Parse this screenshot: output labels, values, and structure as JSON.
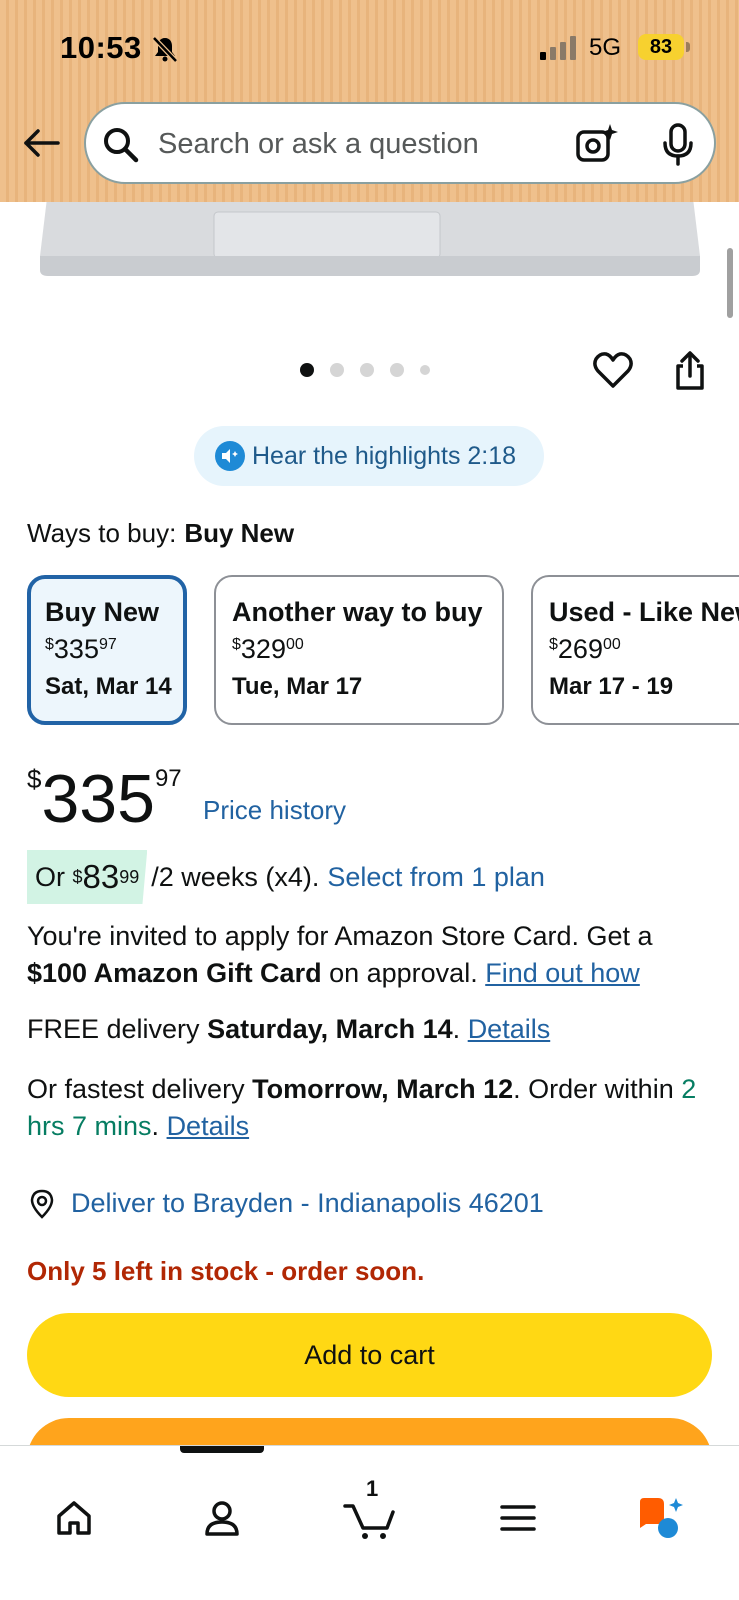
{
  "status_bar": {
    "time": "10:53",
    "network": "5G",
    "battery": "83"
  },
  "search": {
    "placeholder": "Search or ask a question"
  },
  "highlights": {
    "label": "Hear the highlights 2:18"
  },
  "ways_to_buy": {
    "label": "Ways to buy:",
    "selected": "Buy New",
    "options": [
      {
        "title": "Buy New",
        "price_whole": "335",
        "price_fraction": "97",
        "date": "Sat, Mar 14",
        "selected": true
      },
      {
        "title": "Another way to buy",
        "price_whole": "329",
        "price_fraction": "00",
        "date": "Tue, Mar 17",
        "selected": false
      },
      {
        "title": "Used - Like New",
        "price_whole": "269",
        "price_fraction": "00",
        "date": "Mar 17 - 19",
        "selected": false
      }
    ]
  },
  "price": {
    "currency": "$",
    "whole": "335",
    "fraction": "97",
    "history_link": "Price history"
  },
  "installment": {
    "prefix": "Or",
    "currency": "$",
    "amount_whole": "83",
    "amount_fraction": "99",
    "terms": "/2 weeks (x4).",
    "link": "Select from 1 plan"
  },
  "store_card": {
    "text_1": "You're invited to apply for Amazon Store Card. Get a",
    "bold": "$100 Amazon Gift Card",
    "text_2": "on approval.",
    "link": "Find out how"
  },
  "free_delivery": {
    "prefix": "FREE delivery",
    "date": "Saturday, March 14",
    "link": "Details"
  },
  "fastest_delivery": {
    "prefix": "Or fastest delivery",
    "date": "Tomorrow, March 12",
    "order_text": ". Order within",
    "countdown": "2 hrs 7 mins",
    "link": "Details"
  },
  "deliver_to": {
    "label": "Deliver to Brayden - Indianapolis 46201"
  },
  "stock": {
    "message": "Only 5 left in stock - order soon."
  },
  "actions": {
    "add_to_cart": "Add to cart"
  },
  "bottom_nav": {
    "cart_count": "1"
  },
  "carousel": {
    "total_dots": 5,
    "active_index": 0
  },
  "colors": {
    "link": "#2162a1",
    "add_to_cart": "#ffd814",
    "buy_now": "#ffa41c",
    "stock_warning": "#b12704",
    "header": "#efc08c"
  }
}
